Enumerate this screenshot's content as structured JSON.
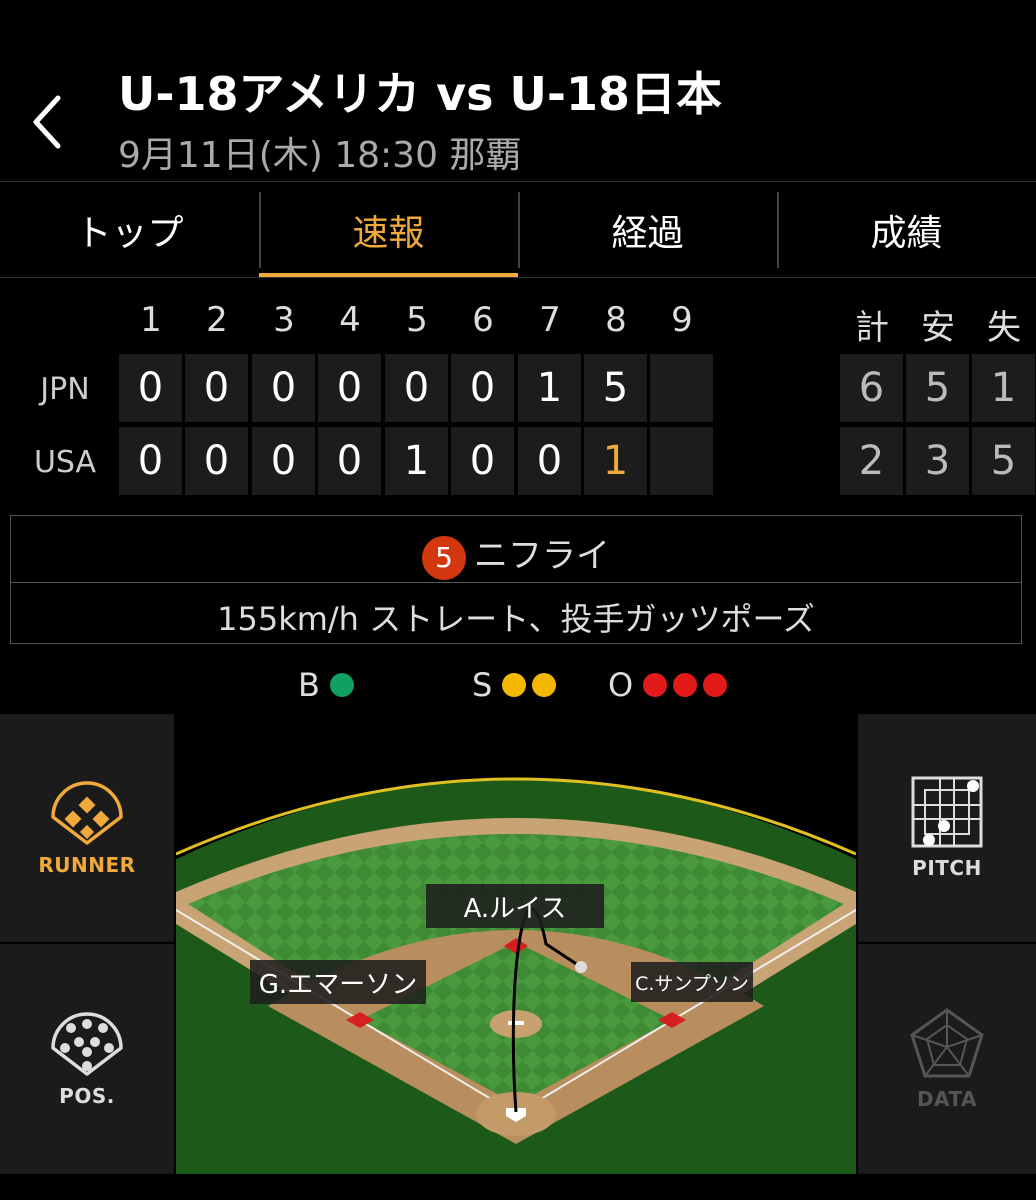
{
  "header": {
    "title": "U-18アメリカ vs U-18日本",
    "subtitle": "9月11日(木) 18:30 那覇"
  },
  "tabs": [
    {
      "label": "トップ",
      "active": false
    },
    {
      "label": "速報",
      "active": true
    },
    {
      "label": "経過",
      "active": false
    },
    {
      "label": "成績",
      "active": false
    }
  ],
  "scoreboard": {
    "innings": [
      "1",
      "2",
      "3",
      "4",
      "5",
      "6",
      "7",
      "8",
      "9"
    ],
    "totals_headers": [
      "計",
      "安",
      "失"
    ],
    "teams": [
      {
        "name": "JPN",
        "innings": [
          "0",
          "0",
          "0",
          "0",
          "0",
          "0",
          "1",
          "5",
          ""
        ],
        "totals": [
          "6",
          "5",
          "1"
        ]
      },
      {
        "name": "USA",
        "innings": [
          "0",
          "0",
          "0",
          "0",
          "1",
          "0",
          "0",
          "1",
          ""
        ],
        "totals": [
          "2",
          "3",
          "5"
        ]
      }
    ],
    "live_color": "#f0a93a"
  },
  "play": {
    "number": "5",
    "title": "ニフライ",
    "description": "155km/h ストレート、投手ガッツポーズ"
  },
  "count": {
    "b_label": "B",
    "balls": 1,
    "ball_color": "#10a060",
    "s_label": "S",
    "strikes": 2,
    "strike_color": "#f5b800",
    "o_label": "O",
    "outs": 3,
    "out_color": "#e21a1a"
  },
  "panel": {
    "runner_label": "RUNNER",
    "pos_label": "POS.",
    "pitch_label": "PITCH",
    "data_label": "DATA",
    "active_color": "#f0a93a"
  },
  "field": {
    "players": {
      "center": "A.ルイス",
      "left": "G.エマーソン",
      "right": "C.サンプソン"
    }
  }
}
